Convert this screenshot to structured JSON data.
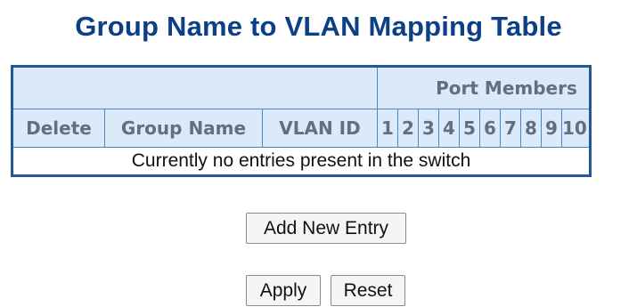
{
  "page": {
    "title": "Group Name to VLAN Mapping Table"
  },
  "table": {
    "port_members_label": "Port Members",
    "columns": {
      "delete": "Delete",
      "group_name": "Group Name",
      "vlan_id": "VLAN ID"
    },
    "ports": [
      "1",
      "2",
      "3",
      "4",
      "5",
      "6",
      "7",
      "8",
      "9",
      "10"
    ],
    "empty_message": "Currently no entries present in the switch"
  },
  "buttons": {
    "add_new_entry": "Add New Entry",
    "apply": "Apply",
    "reset": "Reset"
  },
  "colors": {
    "title": "#0b3f86",
    "header_bg": "#dbe9f9",
    "header_text": "#5f7082",
    "table_border": "#1f5a96"
  }
}
